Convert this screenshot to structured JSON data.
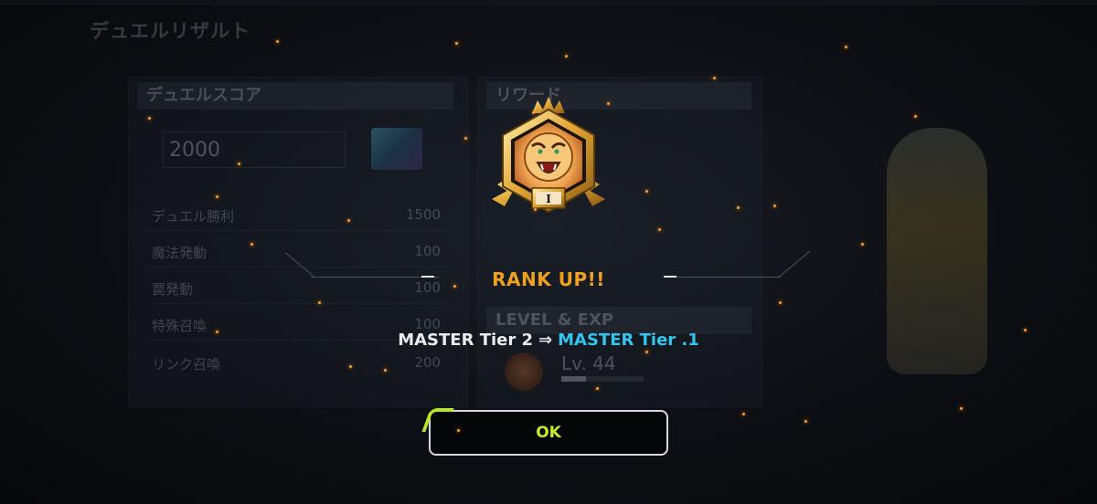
{
  "background_screen": {
    "title": "デュエルリザルト",
    "score_panel": {
      "heading": "デュエルスコア",
      "total": "2000",
      "rows": [
        {
          "label": "デュエル勝利",
          "value": "1500"
        },
        {
          "label": "魔法発動",
          "value": "100"
        },
        {
          "label": "罠発動",
          "value": "100"
        },
        {
          "label": "特殊召喚",
          "value": "100"
        },
        {
          "label": "リンク召喚",
          "value": "200"
        }
      ]
    },
    "reward_panel": {
      "heading": "リワード"
    },
    "level_panel": {
      "heading": "LEVEL & EXP",
      "level": "Lv. 44",
      "exp_fraction": 0.3
    }
  },
  "modal": {
    "emblem_icon": "master-rank-lion-emblem-icon",
    "emblem_numeral": "I",
    "headline": "RANK UP!!",
    "from_rank": "MASTER Tier 2",
    "arrow": "⇒",
    "to_rank": "MASTER Tier .1",
    "ok_label": "OK"
  },
  "colors": {
    "headline": "#f0a21e",
    "new_rank": "#33c4f0",
    "ok_text": "#c2ee2a",
    "ok_accent": "#b8e824",
    "spark": "#ff9a2e"
  }
}
